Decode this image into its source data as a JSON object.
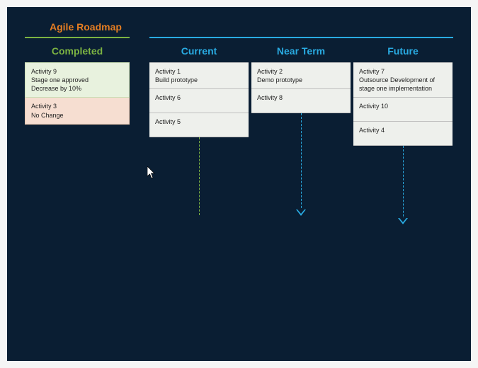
{
  "title": "Agile Roadmap",
  "columns": {
    "completed": {
      "header": "Completed",
      "cards": [
        {
          "title": "Activity 9",
          "desc1": "Stage one approved",
          "desc2": "Decrease by 10%"
        },
        {
          "title": "Activity 3",
          "desc1": "No Change",
          "desc2": ""
        }
      ]
    },
    "current": {
      "header": "Current",
      "cards": [
        {
          "title": "Activity 1",
          "desc1": "Build prototype"
        },
        {
          "title": "Activity 6",
          "desc1": ""
        },
        {
          "title": "Activity 5",
          "desc1": ""
        }
      ]
    },
    "near": {
      "header": "Near Term",
      "cards": [
        {
          "title": "Activity 2",
          "desc1": "Demo prototype"
        },
        {
          "title": "Activity 8",
          "desc1": ""
        }
      ]
    },
    "future": {
      "header": "Future",
      "cards": [
        {
          "title": "Activity 7",
          "desc1": "Outsource Development of stage one implementation"
        },
        {
          "title": "Activity 10",
          "desc1": ""
        },
        {
          "title": "Activity 4",
          "desc1": ""
        }
      ]
    }
  }
}
